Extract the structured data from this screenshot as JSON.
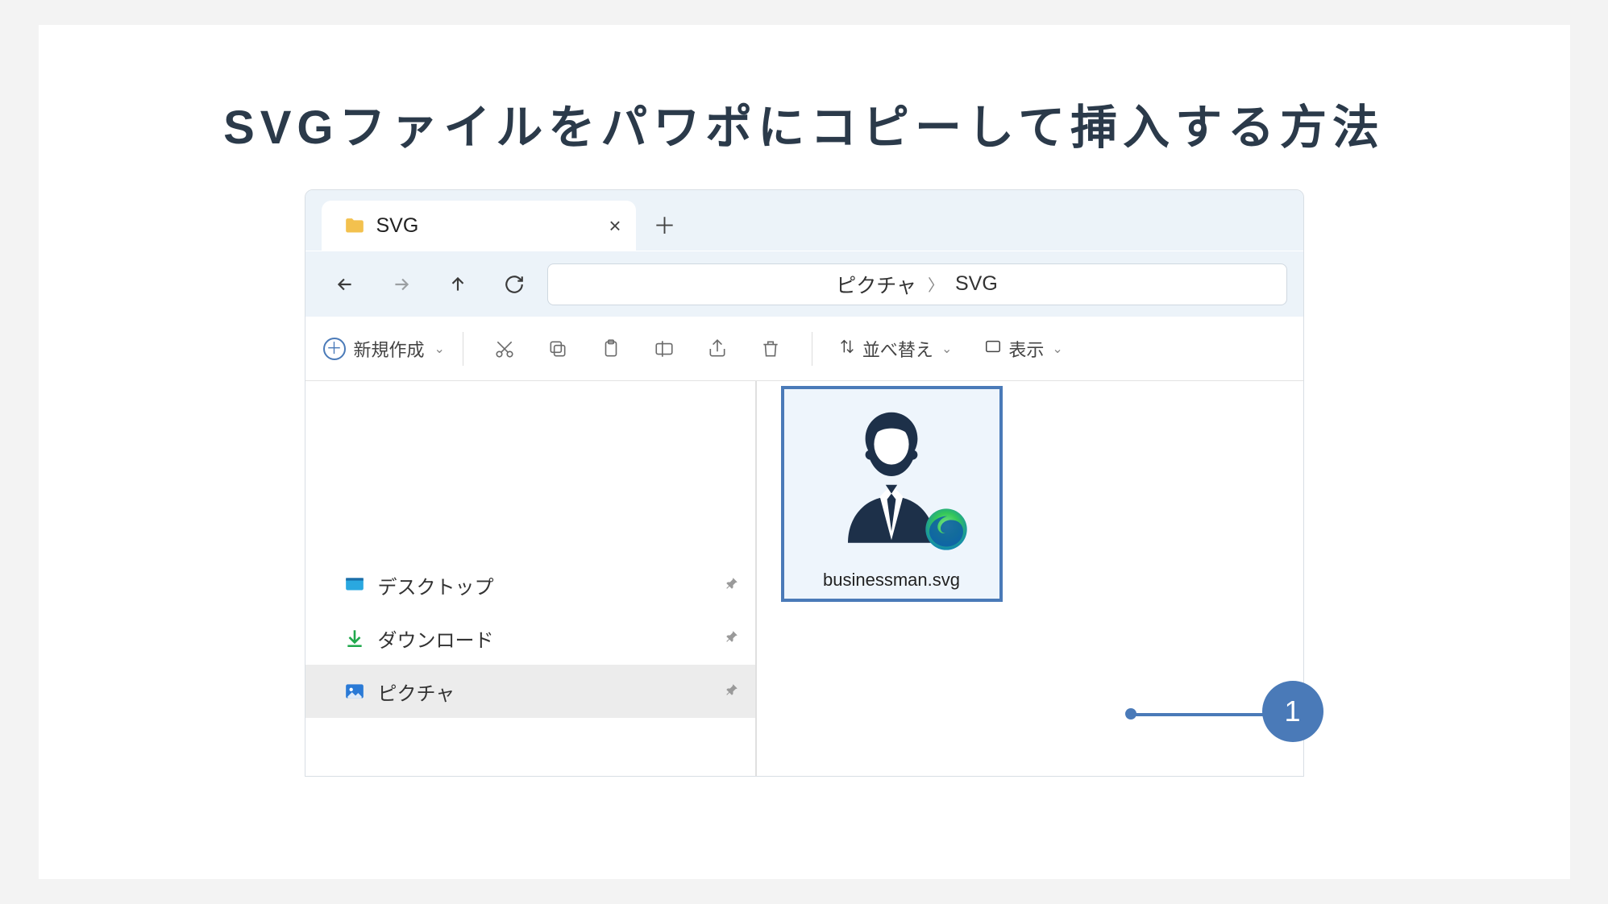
{
  "title": "SVGファイルをパワポにコピーして挿入する方法",
  "explorer": {
    "tab_title": "SVG",
    "breadcrumb": {
      "parent": "ピクチャ",
      "current": "SVG"
    },
    "toolbar": {
      "new": "新規作成",
      "sort": "並べ替え",
      "view": "表示"
    },
    "sidebar": [
      {
        "label": "デスクトップ"
      },
      {
        "label": "ダウンロード"
      },
      {
        "label": "ピクチャ"
      }
    ],
    "file": {
      "name": "businessman.svg"
    }
  },
  "callout": {
    "number": "1"
  }
}
